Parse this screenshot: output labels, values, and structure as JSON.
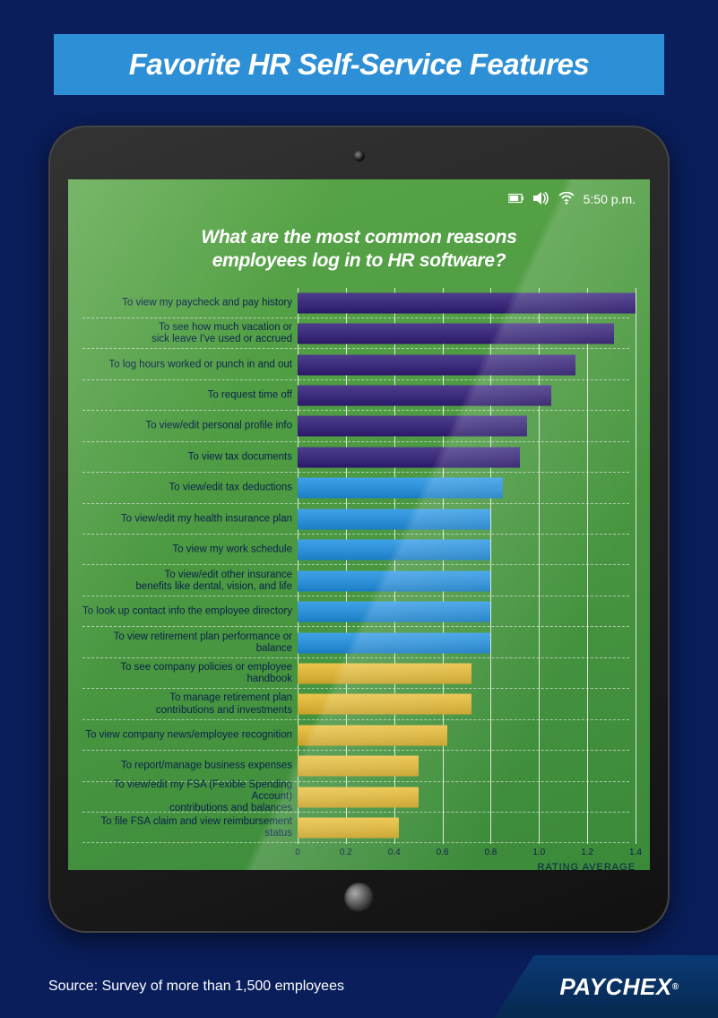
{
  "header": {
    "title": "Favorite HR Self-Service Features"
  },
  "status": {
    "time": "5:50 p.m."
  },
  "question": {
    "line1": "What are the most common reasons",
    "line2": "employees log in to HR software?"
  },
  "chart_data": {
    "type": "bar",
    "orientation": "horizontal",
    "xlabel": "RATING AVERAGE",
    "xlim": [
      0,
      1.4
    ],
    "ticks": [
      0,
      0.2,
      0.4,
      0.6,
      0.8,
      1.0,
      1.2,
      1.4
    ],
    "color_groups": {
      "purple": "#3c2a7a",
      "blue": "#2d8fd6",
      "gold": "#d9b33a"
    },
    "series": [
      {
        "label": "To view my paycheck and pay history",
        "value": 1.4,
        "color": "purple"
      },
      {
        "label": "To see how much vacation or\nsick leave I've used or accrued",
        "value": 1.31,
        "color": "purple"
      },
      {
        "label": "To log hours worked or punch in and out",
        "value": 1.15,
        "color": "purple"
      },
      {
        "label": "To request time off",
        "value": 1.05,
        "color": "purple"
      },
      {
        "label": "To view/edit personal profile info",
        "value": 0.95,
        "color": "purple"
      },
      {
        "label": "To view tax documents",
        "value": 0.92,
        "color": "purple"
      },
      {
        "label": "To view/edit tax deductions",
        "value": 0.85,
        "color": "blue"
      },
      {
        "label": "To view/edit my health insurance plan",
        "value": 0.8,
        "color": "blue"
      },
      {
        "label": "To view my work schedule",
        "value": 0.8,
        "color": "blue"
      },
      {
        "label": "To view/edit other insurance\nbenefits like dental, vision, and life",
        "value": 0.8,
        "color": "blue"
      },
      {
        "label": "To look up contact info the employee directory",
        "value": 0.8,
        "color": "blue"
      },
      {
        "label": "To view retirement plan performance or balance",
        "value": 0.8,
        "color": "blue"
      },
      {
        "label": "To see company policies or employee handbook",
        "value": 0.72,
        "color": "gold"
      },
      {
        "label": "To manage retirement plan\ncontributions and investments",
        "value": 0.72,
        "color": "gold"
      },
      {
        "label": "To view company news/employee recognition",
        "value": 0.62,
        "color": "gold"
      },
      {
        "label": "To report/manage business expenses",
        "value": 0.5,
        "color": "gold"
      },
      {
        "label": "To view/edit my FSA (Fexible Spending Account)\ncontributions and balances",
        "value": 0.5,
        "color": "gold"
      },
      {
        "label": "To file FSA claim and view reimbursement status",
        "value": 0.42,
        "color": "gold"
      }
    ]
  },
  "footer": {
    "source": "Source: Survey of more than 1,500 employees",
    "logo_text": "PAYCHEX"
  }
}
